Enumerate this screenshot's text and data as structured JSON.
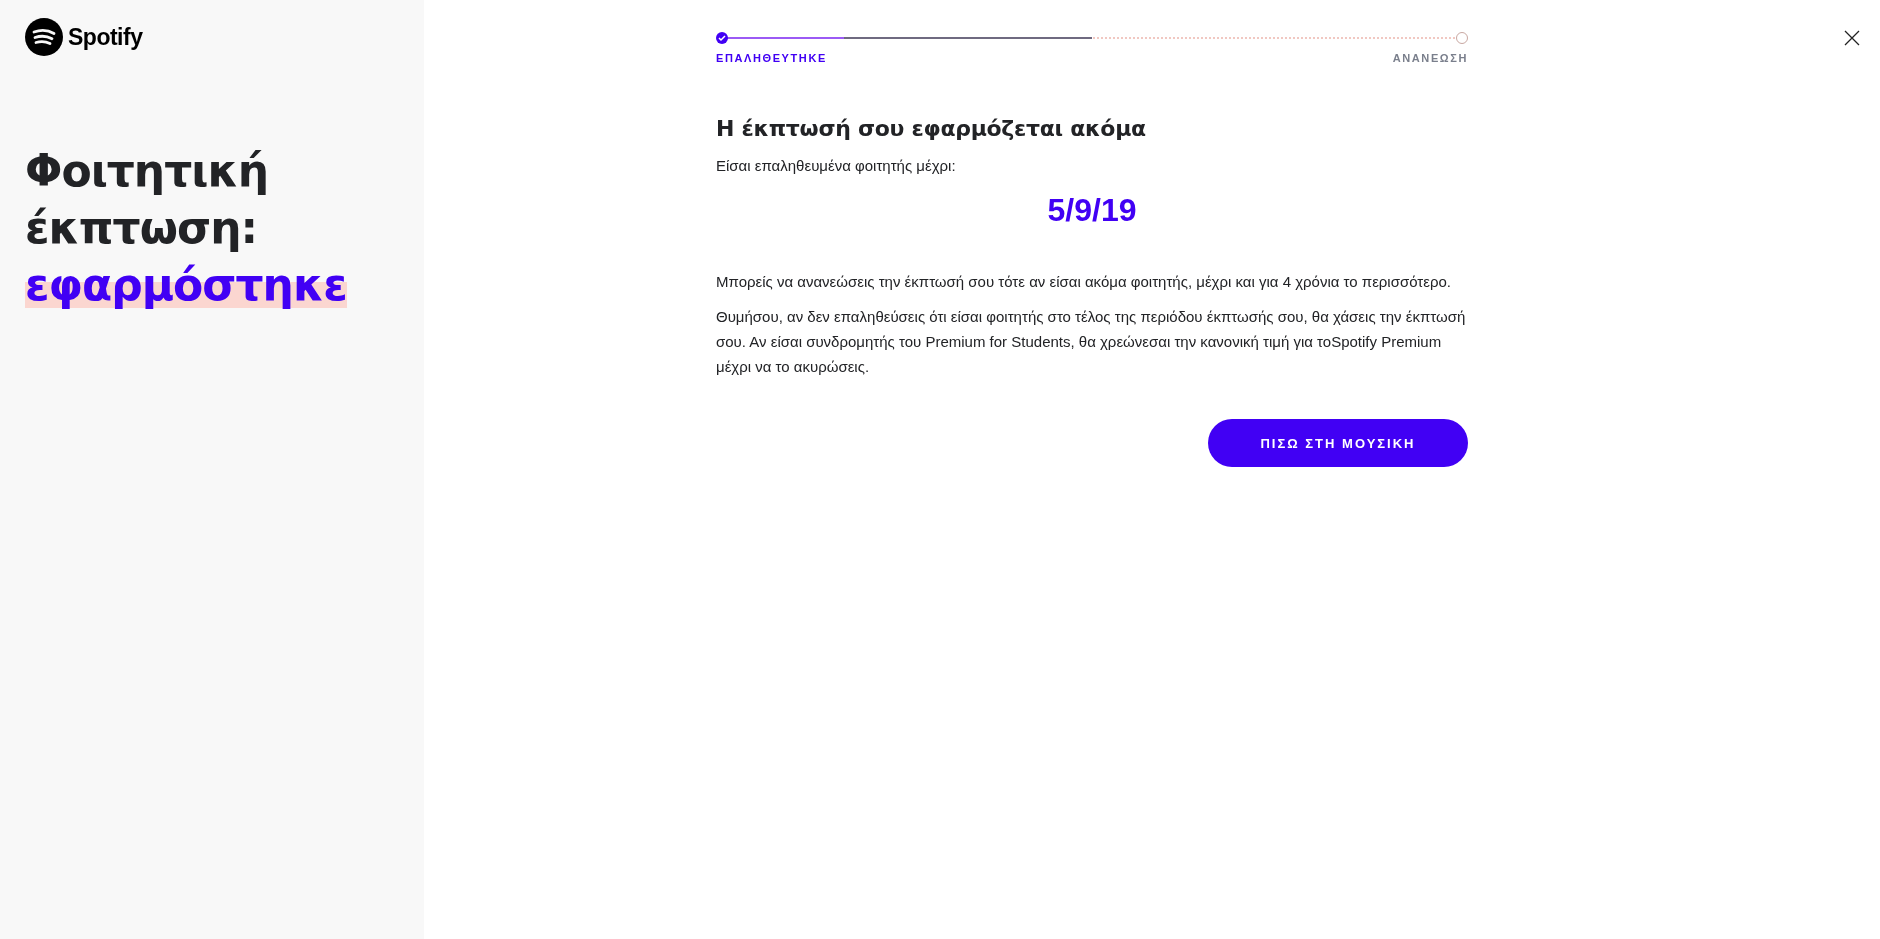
{
  "sidebar": {
    "logo": "Spotify",
    "title_lines": [
      "Φοιτητική",
      "έκπτωση:"
    ],
    "title_highlight": "εφαρμόστηκε"
  },
  "progress": {
    "level": 0.5,
    "steps": [
      {
        "label": "ΕΠΑΛΗΘΕΥΤΗΚΕ",
        "done": true
      },
      {
        "label": "ΑΝΑΝΕΩΣΗ",
        "done": false
      }
    ]
  },
  "heading": "Η έκπτωσή σου εφαρμόζεται ακόμα",
  "intro": "Είσαι επαληθευμένα φοιτητής μέχρι:",
  "date": "5/9/19",
  "paragraphs": [
    "Μπορείς να ανανεώσεις την έκπτωσή σου τότε αν είσαι ακόμα φοιτητής, μέχρι και για 4 χρόνια το περισσότερο.",
    "Θυμήσου, αν δεν επαληθεύσεις ότι είσαι φοιτητής στο τέλος της περιόδου έκπτωσής σου, θα χάσεις την έκπτωσή σου. Αν είσαι συνδρομητής του Premium for Students, θα χρεώνεσαι την κανονική τιμή για τοSpotify Premium μέχρι να το ακυρώσεις."
  ],
  "button": "ΠΙΣΩ ΣΤΗ ΜΟΥΣΙΚΗ"
}
